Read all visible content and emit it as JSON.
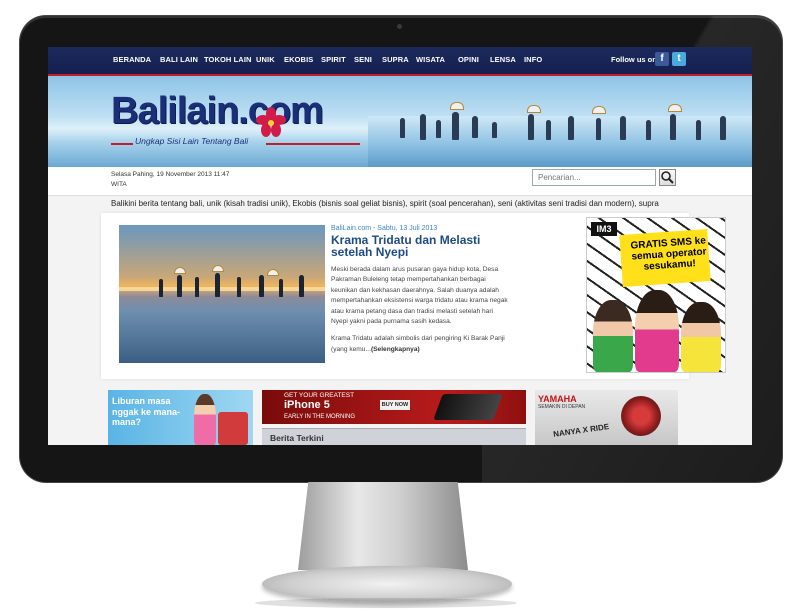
{
  "nav": {
    "items": [
      "BERANDA",
      "BALI LAIN",
      "TOKOH LAIN",
      "UNIK",
      "EKOBIS",
      "SPIRIT",
      "SENI",
      "SUPRA",
      "WISATA",
      "OPINI",
      "LENSA",
      "INFO"
    ],
    "follow_label": "Follow us on",
    "social": [
      {
        "icon": "facebook-icon",
        "glyph": "f"
      },
      {
        "icon": "twitter-icon",
        "glyph": "t"
      }
    ]
  },
  "banner": {
    "logo_text": "Balilain.com",
    "tagline": "Ungkap Sisi Lain Tentang Bali"
  },
  "info": {
    "date_line1": "Selasa Pahing,  19 November 2013 11:47",
    "date_line2": "WITA",
    "search_placeholder": "Pencarian..."
  },
  "ticker": "Balikini berita tentang bali, unik (kisah tradisi unik), Ekobis (bisnis soal geliat bisnis), spirit (soal pencerahan), seni (aktivitas seni tradisi dan modern), supra",
  "feature": {
    "meta": "BaliLain.com - Sabtu, 13 Juli 2013",
    "headline": "Krama Tridatu dan Melasti setelah Nyepi",
    "summary": "Meski berada dalam arus pusaran gaya hidup kota, Desa Pakraman Buleleng tetap mempertahankan berbagai keunikan dan kekhasan daerahnya. Salah duanya adalah mempertahankan eksistensi warga tridatu atau krama negak atau krama petang dasa dan tradisi melasti setelah hari Nyepi yakni pada purnama sasih kedasa.",
    "summary2": "Krama Tridatu adalah simbolis dari pengiring Ki Barak Panji (yang kemu...",
    "more": "(Selengkapnya)"
  },
  "ads": {
    "im3_logo": "IM3",
    "im3_title": "GRATIS SMS ke semua operator sesukamu!",
    "liburan": "Liburan masa nggak ke mana-mana?",
    "iphone_line1": "GET YOUR GREATEST",
    "iphone_line2": "iPhone 5",
    "iphone_line3": "EARLY IN THE MORNING",
    "iphone_buy": "BUY NOW",
    "yamaha_title": "YAMAHA",
    "yamaha_sub": "SEMAKIN DI DEPAN",
    "yamaha_x": "NANYA X RIDE"
  },
  "berita_title": "Berita Terkini",
  "colors": {
    "nav": "#1d2a5c",
    "accent": "#c31c2a",
    "headline": "#1e4a86",
    "meta": "#3d86c9"
  }
}
